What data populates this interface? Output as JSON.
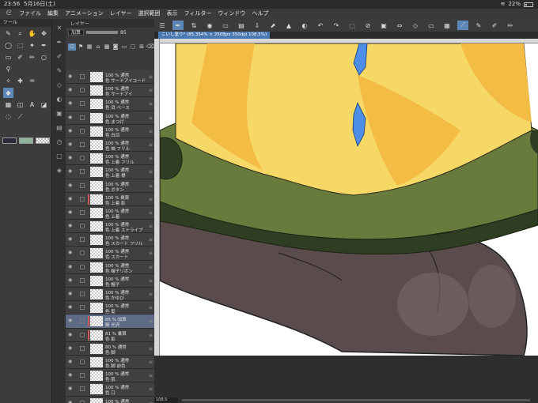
{
  "status": {
    "time": "23:56",
    "date": "5月16日(土)",
    "battery": "22%"
  },
  "menu": [
    "ファイル",
    "編集",
    "アニメーション",
    "レイヤー",
    "選択範囲",
    "表示",
    "フィルター",
    "ウィンドウ",
    "ヘルプ"
  ],
  "tool_panel": {
    "header": "ツール"
  },
  "layer_panel": {
    "tab": "レイヤー",
    "blend": "加算",
    "opacity": "85"
  },
  "document_tab": "こいし塗り* (85.354% × 2508px 350dpi 108.5%)",
  "zoom": "108.5",
  "layers": [
    {
      "opacity": "100 % 通常",
      "name": "色 サードアイコード",
      "clip": false,
      "sel": false
    },
    {
      "opacity": "100 % 通常",
      "name": "色 サードアイ",
      "clip": false,
      "sel": false
    },
    {
      "opacity": "100 % 通常",
      "name": "色 目 ベース",
      "clip": false,
      "sel": false
    },
    {
      "opacity": "100 % 通常",
      "name": "色 まつげ",
      "clip": false,
      "sel": false
    },
    {
      "opacity": "100 % 通常",
      "name": "色 白目",
      "clip": false,
      "sel": false
    },
    {
      "opacity": "100 % 通常",
      "name": "色 袖 フリル",
      "clip": false,
      "sel": false
    },
    {
      "opacity": "100 % 通常",
      "name": "色 上着 フリル",
      "clip": false,
      "sel": false
    },
    {
      "opacity": "100 % 通常",
      "name": "色 上着 襟",
      "clip": false,
      "sel": false
    },
    {
      "opacity": "100 % 通常",
      "name": "色 ボタン",
      "clip": false,
      "sel": false
    },
    {
      "opacity": "100 % 乗算",
      "name": "色 上着 影",
      "clip": true,
      "sel": false
    },
    {
      "opacity": "100 % 通常",
      "name": "色 上着",
      "clip": false,
      "sel": false
    },
    {
      "opacity": "100 % 通常",
      "name": "色 上着 ストライプ",
      "clip": false,
      "sel": false
    },
    {
      "opacity": "100 % 通常",
      "name": "色 スカート フリル",
      "clip": false,
      "sel": false
    },
    {
      "opacity": "100 % 通常",
      "name": "色 スカート",
      "clip": false,
      "sel": false
    },
    {
      "opacity": "100 % 通常",
      "name": "色 帽子リボン",
      "clip": false,
      "sel": false
    },
    {
      "opacity": "100 % 通常",
      "name": "色 帽子",
      "clip": false,
      "sel": false
    },
    {
      "opacity": "100 % 通常",
      "name": "色 かゆび",
      "clip": false,
      "sel": false
    },
    {
      "opacity": "100 % 通常",
      "name": "色 髪",
      "clip": false,
      "sel": false
    },
    {
      "opacity": "85 % 加算",
      "name": "脚 光沢",
      "clip": true,
      "sel": true
    },
    {
      "opacity": "81 % 乗算",
      "name": "色 影",
      "clip": true,
      "sel": false
    },
    {
      "opacity": "80 % 通常",
      "name": "色 脚",
      "clip": false,
      "sel": false
    },
    {
      "opacity": "100 % 通常",
      "name": "色 脚 前色",
      "clip": false,
      "sel": false
    },
    {
      "opacity": "100 % 通常",
      "name": "色 肌",
      "clip": false,
      "sel": false
    },
    {
      "opacity": "100 % 通常",
      "name": "色 口",
      "clip": false,
      "sel": false
    },
    {
      "opacity": "100 % 通常",
      "name": "色 顔",
      "clip": false,
      "sel": false
    }
  ],
  "colors": {
    "main": "#2a2a3a",
    "sub": "#8fb59a",
    "accent": "#5d87b5"
  }
}
